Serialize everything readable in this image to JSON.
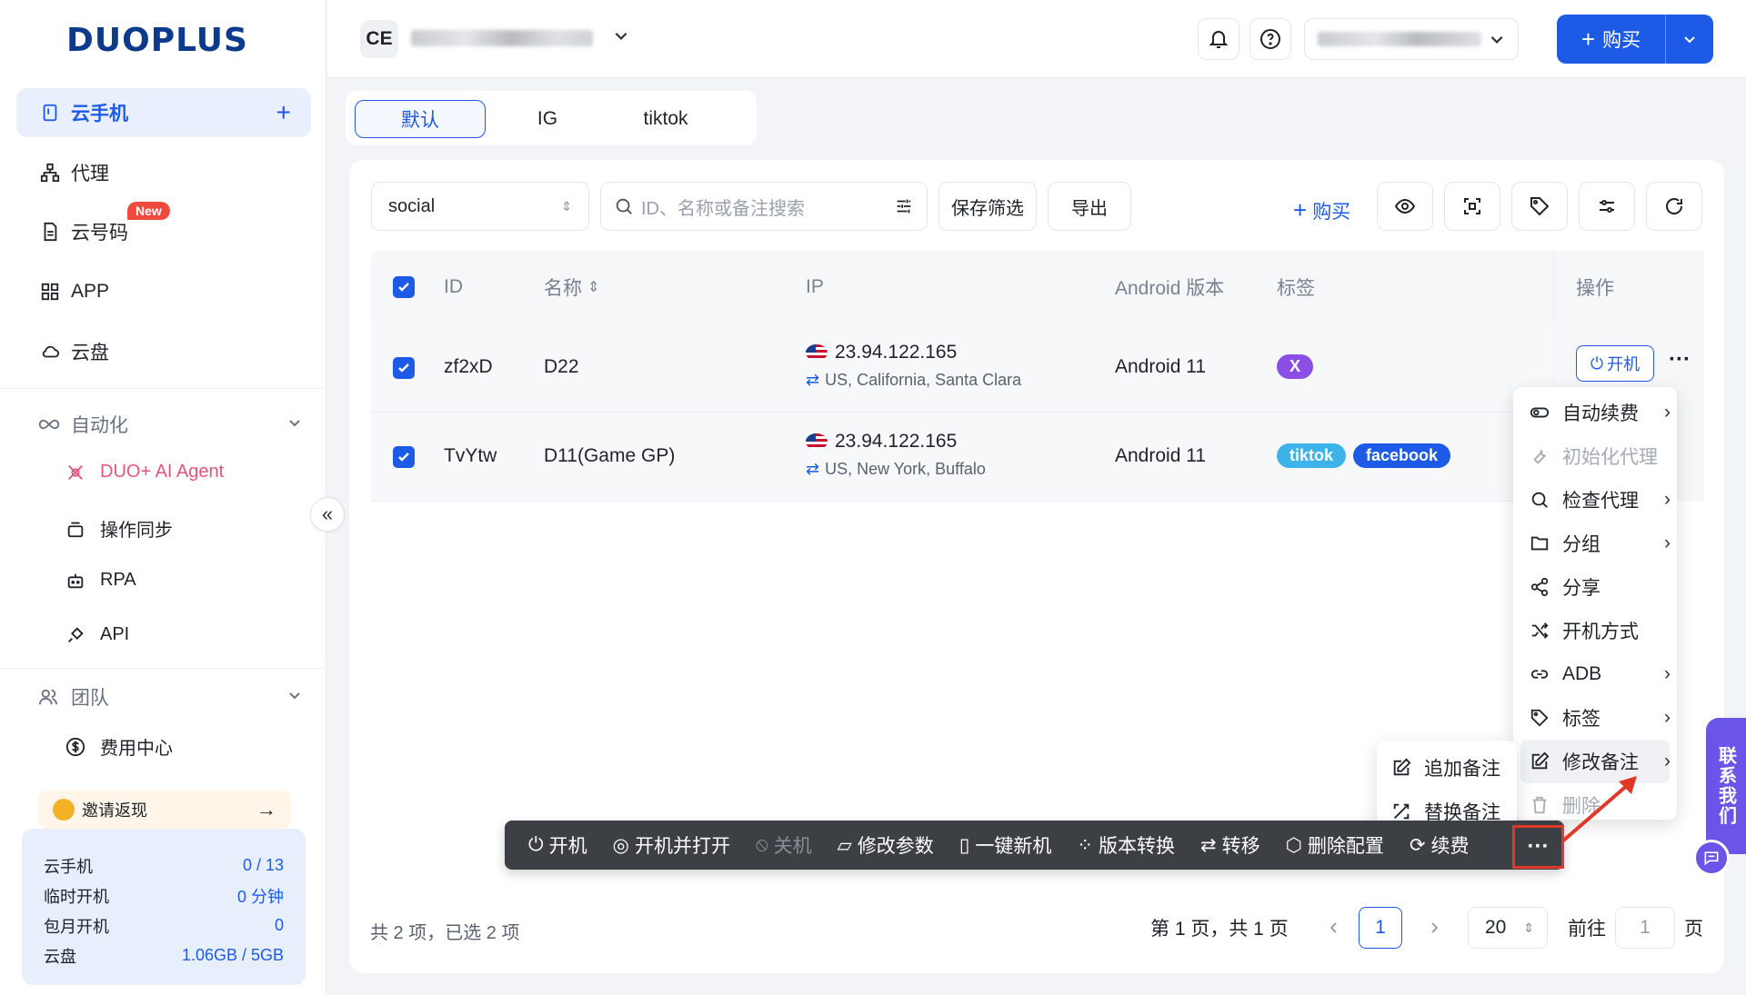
{
  "brand": {
    "logo_text": "DUOPLUS"
  },
  "sidebar": {
    "cloud_phone": "云手机",
    "proxy": "代理",
    "cloud_number": "云号码",
    "new_badge": "New",
    "app": "APP",
    "cloud_disk": "云盘",
    "automation": "自动化",
    "ai_agent": "DUO+ AI Agent",
    "op_sync": "操作同步",
    "rpa": "RPA",
    "api": "API",
    "team": "团队",
    "billing": "费用中心",
    "invite": "邀请返现",
    "stats": [
      {
        "label": "云手机",
        "value": "0 / 13"
      },
      {
        "label": "临时开机",
        "value": "0 分钟"
      },
      {
        "label": "包月开机",
        "value": "0"
      },
      {
        "label": "云盘",
        "value": "1.06GB / 5GB"
      }
    ]
  },
  "header": {
    "workspace_initials": "CE",
    "buy_label": "购买"
  },
  "tabs": [
    "默认",
    "IG",
    "tiktok"
  ],
  "toolbar": {
    "group_select": "social",
    "search_placeholder": "ID、名称或备注搜索",
    "save_filter": "保存筛选",
    "export": "导出",
    "buy": "购买"
  },
  "table": {
    "headers": {
      "id": "ID",
      "name": "名称",
      "ip": "IP",
      "android": "Android 版本",
      "tags": "标签",
      "ops": "操作"
    },
    "rows": [
      {
        "id": "zf2xD",
        "name": "D22",
        "ip": "23.94.122.165",
        "location": "US, California, Santa Clara",
        "android": "Android 11",
        "tags": [
          "X"
        ]
      },
      {
        "id": "TvYtw",
        "name": "D11(Game GP)",
        "ip": "23.94.122.165",
        "location": "US, New York, Buffalo",
        "android": "Android 11",
        "tags": [
          "tiktok",
          "facebook"
        ]
      }
    ],
    "start_label": "开机"
  },
  "action_bar": {
    "items": [
      "开机",
      "开机并打开",
      "关机",
      "修改参数",
      "一键新机",
      "版本转换",
      "转移",
      "删除配置",
      "续费"
    ]
  },
  "more_menu": {
    "items": [
      "自动续费",
      "初始化代理",
      "检查代理",
      "分组",
      "分享",
      "开机方式",
      "ADB",
      "标签",
      "修改备注",
      "删除"
    ]
  },
  "note_submenu": {
    "items": [
      "追加备注",
      "替换备注"
    ]
  },
  "footer": {
    "summary": "共 2 项，已选 2 项",
    "page_info": "第 1 页，共 1 页",
    "current_page": "1",
    "page_size": "20",
    "goto_label": "前往",
    "goto_value": "1",
    "page_suffix": "页"
  },
  "contact": "联系我们",
  "colors": {
    "primary": "#1d5be6",
    "tag_x": "#8b4fe6",
    "tag_tiktok": "#3cb4ea",
    "tag_facebook": "#1d5be6",
    "highlight": "#e0392a"
  }
}
